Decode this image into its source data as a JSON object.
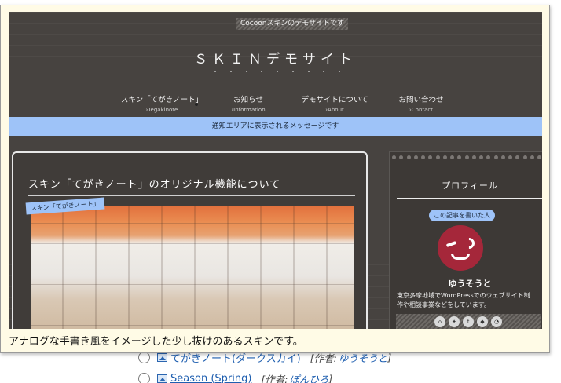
{
  "skin_list": [
    {
      "name": "てがきノート(ダークスカイ)",
      "author_label": "[作者:",
      "author": "ゆうそうと",
      "close": "]"
    },
    {
      "name": "Season (Spring)",
      "author_label": "[作者:",
      "author": "ぽんひろ",
      "close": "]"
    }
  ],
  "tooltip": {
    "description": "アナログな手書き風をイメージした少し抜けのあるスキンです。",
    "preview": {
      "tagline": "Cocoonスキンのデモサイトです",
      "site_title": "ＳＫＩＮデモサイト",
      "nav": [
        {
          "label": "スキン「てがきノート」",
          "sub": "›Tegakinote"
        },
        {
          "label": "お知らせ",
          "sub": "›Information"
        },
        {
          "label": "デモサイトについて",
          "sub": "›About"
        },
        {
          "label": "お問い合わせ",
          "sub": "›Contact"
        }
      ],
      "notice": "通知エリアに表示されるメッセージです",
      "article_title": "スキン「てがきノート」のオリジナル機能について",
      "category_label": "スキン「てがきノート」",
      "sidebar": {
        "title": "プロフィール",
        "bubble": "この記事を書いた人",
        "author_name": "ゆうそうと",
        "bio": "東京多摩地域でWordPressでのウェブサイト制作や相談事業などをしています。",
        "social": [
          "home",
          "twitter",
          "facebook",
          "feedly",
          "rss"
        ]
      }
    }
  }
}
